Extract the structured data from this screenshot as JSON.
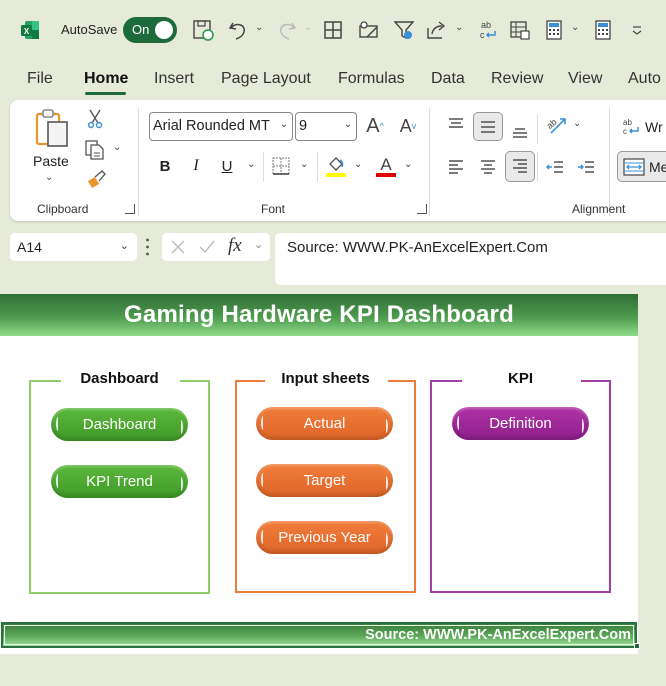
{
  "qat": {
    "autosave_label": "AutoSave",
    "autosave_state": "On",
    "icons": [
      "excel-logo-icon",
      "save-icon",
      "undo-icon",
      "redo-icon",
      "borders-icon",
      "email-attach-icon",
      "filter-icon",
      "share-icon",
      "spelling-icon",
      "table-icon",
      "calculator-icon",
      "calculate-sheet-icon",
      "customize-qat-icon"
    ]
  },
  "tabs": [
    {
      "label": "File"
    },
    {
      "label": "Home",
      "active": true
    },
    {
      "label": "Insert"
    },
    {
      "label": "Page Layout"
    },
    {
      "label": "Formulas"
    },
    {
      "label": "Data"
    },
    {
      "label": "Review"
    },
    {
      "label": "View"
    },
    {
      "label": "Auto"
    }
  ],
  "ribbon": {
    "clipboard": {
      "label": "Clipboard",
      "paste_label": "Paste"
    },
    "font": {
      "label": "Font",
      "font_name": "Arial Rounded MT",
      "font_size": "9",
      "bold": "B",
      "italic": "I",
      "underline": "U",
      "highlight_color": "#ffff00",
      "font_color": "#e00000"
    },
    "alignment": {
      "label": "Alignment",
      "wrap_label": "Wr",
      "merge_label": "Me"
    }
  },
  "formula_bar": {
    "name_box": "A14",
    "fx": "fx",
    "formula": "Source: WWW.PK-AnExcelExpert.Com"
  },
  "sheet": {
    "title": "Gaming Hardware KPI Dashboard",
    "footer": "Source: WWW.PK-AnExcelExpert.Com",
    "panels": [
      {
        "title": "Dashboard",
        "color": "#8fcf6a",
        "buttons": [
          "Dashboard",
          "KPI Trend"
        ],
        "button_color": "#4fa832"
      },
      {
        "title": "Input sheets",
        "color": "#ec7d3d",
        "buttons": [
          "Actual",
          "Target",
          "Previous Year"
        ],
        "button_color": "#ea6f2d"
      },
      {
        "title": "KPI",
        "color": "#a03fa8",
        "buttons": [
          "Definition"
        ],
        "button_color": "#a0289a"
      }
    ]
  }
}
